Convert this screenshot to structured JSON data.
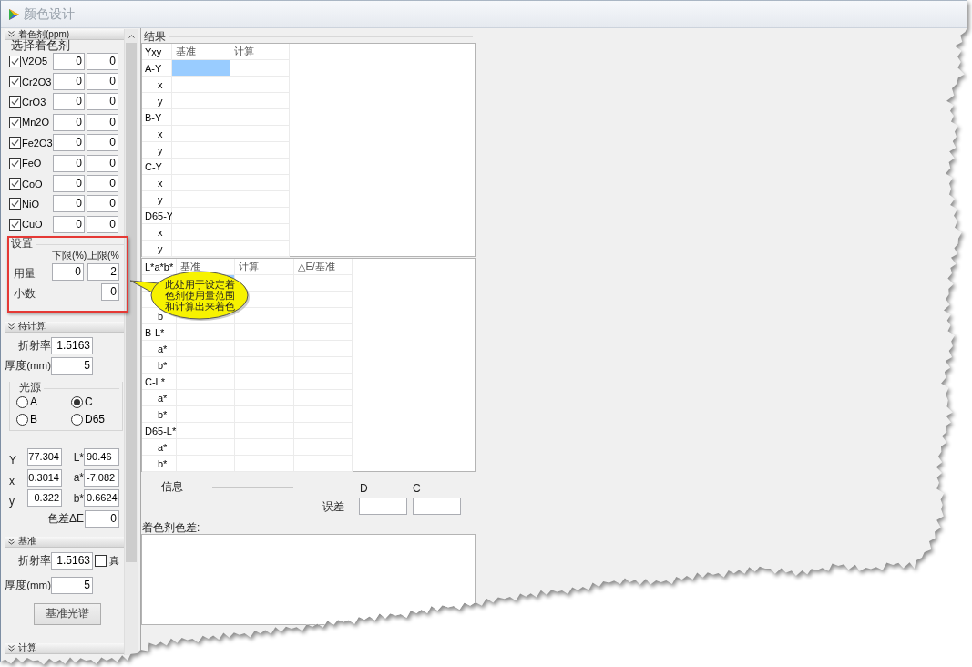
{
  "window": {
    "title": "颜色设计"
  },
  "colorants": {
    "header": "着色剂(ppm)",
    "title": "选择着色剂",
    "items": [
      {
        "name": "V2O5",
        "checked": true,
        "values": [
          "0",
          "0"
        ]
      },
      {
        "name": "Cr2O3",
        "checked": true,
        "values": [
          "0",
          "0"
        ]
      },
      {
        "name": "CrO3",
        "checked": true,
        "values": [
          "0",
          "0"
        ]
      },
      {
        "name": "Mn2O",
        "checked": true,
        "values": [
          "0",
          "0"
        ]
      },
      {
        "name": "Fe2O3",
        "checked": true,
        "values": [
          "0",
          "0"
        ]
      },
      {
        "name": "FeO",
        "checked": true,
        "values": [
          "0",
          "0"
        ]
      },
      {
        "name": "CoO",
        "checked": true,
        "values": [
          "0",
          "0"
        ]
      },
      {
        "name": "NiO",
        "checked": true,
        "values": [
          "0",
          "0"
        ]
      },
      {
        "name": "CuO",
        "checked": true,
        "values": [
          "0",
          "0"
        ]
      }
    ]
  },
  "settings": {
    "title": "设置",
    "columns": [
      "下限(%)",
      "上限(%"
    ],
    "rows": [
      {
        "kind": "range",
        "label": "用量",
        "values": [
          "0",
          "2"
        ]
      },
      {
        "kind": "single",
        "label": "小数",
        "values": [
          "0"
        ]
      }
    ]
  },
  "to_calculate": {
    "header": "待计算",
    "fields": [
      {
        "label": "折射率",
        "value": "1.5163"
      },
      {
        "label": "厚度(mm)",
        "value": "5"
      }
    ],
    "light_source": {
      "title": "光源",
      "options": [
        {
          "label": "A",
          "selected": false
        },
        {
          "label": "C",
          "selected": true
        },
        {
          "label": "B",
          "selected": false
        },
        {
          "label": "D65",
          "selected": false
        }
      ]
    },
    "readings": [
      {
        "left": {
          "label": "Y",
          "value": "77.304"
        },
        "right": {
          "label": "L*",
          "value": "90.46"
        }
      },
      {
        "left": {
          "label": "x",
          "value": "0.3014"
        },
        "right": {
          "label": "a*",
          "value": "-7.082"
        }
      },
      {
        "left": {
          "label": "y",
          "value": "0.322"
        },
        "right": {
          "label": "b*",
          "value": "0.6624"
        }
      }
    ],
    "delta_e": {
      "label": "色差ΔE",
      "value": "0"
    }
  },
  "reference": {
    "header": "基准",
    "fields": [
      {
        "label": "折射率",
        "value": "1.5163"
      },
      {
        "label": "厚度(mm)",
        "value": "5"
      }
    ],
    "vacuum": {
      "label": "真",
      "checked": false
    },
    "button": "基准光谱"
  },
  "calculate": {
    "header": "计算"
  },
  "results": {
    "title": "结果",
    "tables": [
      {
        "kind": "yxy",
        "columns": [
          "Yxy",
          "基准",
          "计算"
        ],
        "rows": [
          {
            "label": "A-Y",
            "cells": [
              {
                "selected": true
              },
              {
                "selected": false
              }
            ],
            "children": [
              {
                "label": "x",
                "cells": [
                  {
                    "selected": false
                  },
                  {
                    "selected": false
                  }
                ]
              },
              {
                "label": "y",
                "cells": [
                  {
                    "selected": false
                  },
                  {
                    "selected": false
                  }
                ]
              }
            ]
          },
          {
            "label": "B-Y",
            "cells": [
              {
                "selected": false
              },
              {
                "selected": false
              }
            ],
            "children": [
              {
                "label": "x",
                "cells": [
                  {
                    "selected": false
                  },
                  {
                    "selected": false
                  }
                ]
              },
              {
                "label": "y",
                "cells": [
                  {
                    "selected": false
                  },
                  {
                    "selected": false
                  }
                ]
              }
            ]
          },
          {
            "label": "C-Y",
            "cells": [
              {
                "selected": false
              },
              {
                "selected": false
              }
            ],
            "children": [
              {
                "label": "x",
                "cells": [
                  {
                    "selected": false
                  },
                  {
                    "selected": false
                  }
                ]
              },
              {
                "label": "y",
                "cells": [
                  {
                    "selected": false
                  },
                  {
                    "selected": false
                  }
                ]
              }
            ]
          },
          {
            "label": "D65-Y",
            "cells": [
              {
                "selected": false
              },
              {
                "selected": false
              }
            ],
            "children": [
              {
                "label": "x",
                "cells": [
                  {
                    "selected": false
                  },
                  {
                    "selected": false
                  }
                ]
              },
              {
                "label": "y",
                "cells": [
                  {
                    "selected": false
                  },
                  {
                    "selected": false
                  }
                ]
              }
            ]
          }
        ]
      },
      {
        "kind": "lab",
        "columns": [
          "L*a*b*",
          "基准",
          "计算",
          "△E/基准"
        ],
        "rows": [
          {
            "cells": [
              {
                "selected": true
              },
              {
                "selected": false
              },
              {
                "selected": false
              }
            ],
            "children": [
              {
                "cells": [
                  {},
                  {
                    "selected": false
                  },
                  {
                    "selected": false
                  }
                ]
              },
              {
                "label": "b",
                "cells": [
                  {
                    "selected": false
                  },
                  {
                    "selected": false
                  },
                  {
                    "selected": false
                  }
                ]
              }
            ]
          },
          {
            "label": "B-L*",
            "cells": [
              {
                "selected": false
              },
              {
                "selected": false
              },
              {
                "selected": false
              }
            ],
            "children": [
              {
                "label": "a*",
                "cells": [
                  {
                    "selected": false
                  },
                  {
                    "selected": false
                  },
                  {
                    "selected": false
                  }
                ]
              },
              {
                "label": "b*",
                "cells": [
                  {
                    "selected": false
                  },
                  {
                    "selected": false
                  },
                  {
                    "selected": false
                  }
                ]
              }
            ]
          },
          {
            "label": "C-L*",
            "cells": [
              {
                "selected": false
              },
              {
                "selected": false
              },
              {
                "selected": false
              }
            ],
            "children": [
              {
                "label": "a*",
                "cells": [
                  {
                    "selected": false
                  },
                  {
                    "selected": false
                  },
                  {
                    "selected": false
                  }
                ]
              },
              {
                "label": "b*",
                "cells": [
                  {
                    "selected": false
                  },
                  {
                    "selected": false
                  },
                  {
                    "selected": false
                  }
                ]
              }
            ]
          },
          {
            "label": "D65-L*",
            "cells": [
              {
                "selected": false
              },
              {
                "selected": false
              },
              {
                "selected": false
              }
            ],
            "children": [
              {
                "label": "a*",
                "cells": [
                  {
                    "selected": false
                  },
                  {
                    "selected": false
                  },
                  {
                    "selected": false
                  }
                ]
              },
              {
                "label": "b*",
                "cells": [
                  {
                    "selected": false
                  },
                  {
                    "selected": false
                  },
                  {
                    "selected": false
                  }
                ]
              }
            ]
          }
        ]
      }
    ]
  },
  "info": {
    "label": "信息",
    "columns": [
      "D",
      "C"
    ],
    "error": {
      "label": "误差"
    }
  },
  "colorant_difference": {
    "label": "着色剂色差:"
  },
  "callout": {
    "text": "此处用于设定着色剂使用量范围和计算出来着色"
  }
}
